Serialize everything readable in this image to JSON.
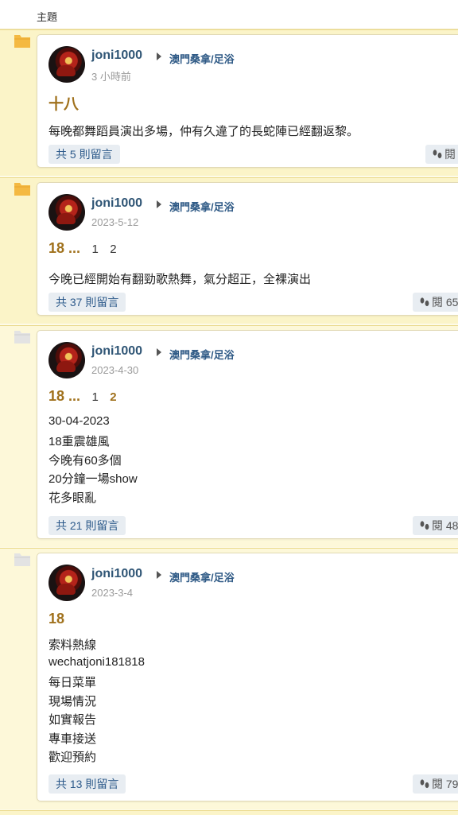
{
  "header": {
    "label": "主題"
  },
  "posts": [
    {
      "username": "joni1000",
      "forum": "澳門桑拿/足浴",
      "time": "3 小時前",
      "title": "十八",
      "pages": [],
      "body": [
        "每晚都舞蹈員演出多場，仲有久違了的長蛇陣已經翻返黎。"
      ],
      "comments": "共 5 則留言",
      "views": "閱"
    },
    {
      "username": "joni1000",
      "forum": "澳門桑拿/足浴",
      "time": "2023-5-12",
      "title": "18 ...",
      "pages": [
        "1",
        "2"
      ],
      "body": [
        "今晚已經開始有翻勁歌熱舞，氣分超正，全裸演出"
      ],
      "comments": "共 37 則留言",
      "views": "閱 65"
    },
    {
      "username": "joni1000",
      "forum": "",
      "time": "2023-4-30",
      "title": "18 ...",
      "pages": [
        "1",
        "2"
      ],
      "body": [
        "30-04-2023",
        "18重震雄風",
        "今晚有60多個",
        "20分鐘一場show",
        "花多眼亂"
      ],
      "comments": "共 21 則留言",
      "views": "閱 48"
    },
    {
      "username": "joni1000",
      "forum": "澳門桑拿/足浴",
      "time": "2023-3-4",
      "title": "18",
      "pages": [],
      "body": [
        "索料熱線",
        "wechatjoni181818",
        "每日菜單",
        "現場情況",
        "如實報告",
        "專車接送",
        "歡迎預約"
      ],
      "comments": "共 13 則留言",
      "views": "閱 79"
    }
  ],
  "colors": {
    "background": "#fbf4c8",
    "accent": "#a0711c",
    "link": "#2f5575",
    "new_folder": "#f4b942",
    "read_folder": "#e3e3e3"
  },
  "icons": {
    "folder_new": "folder-new-icon",
    "folder_read": "folder-read-icon",
    "views": "footprints-icon"
  }
}
